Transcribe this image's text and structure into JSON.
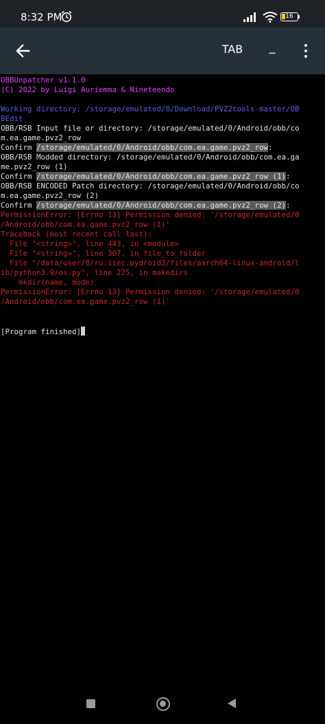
{
  "status_bar": {
    "time": "8:32 PM",
    "battery": "16",
    "icons": [
      "alarm-icon",
      "signal-icon",
      "wifi-icon",
      "battery-icon"
    ]
  },
  "app_bar": {
    "back_icon": "arrow-left-icon",
    "tab_label": "TAB",
    "underscore_label": "_",
    "menu_icon": "more-vertical-icon"
  },
  "terminal": {
    "header_1": "OBBUnpatcher v1.1.0",
    "header_2": "(C) 2022 by Luigi Auriemma & Nineteendo",
    "working_dir_1": "Working directory: /storage/emulated/0/Download/PVZ2tools-master/OB",
    "working_dir_2": "BEdit",
    "input_1": "OBB/RSB Input file or directory: /storage/emulated/0/Android/obb/co",
    "input_2": "m.ea.game.pvz2_row",
    "confirm_label": "Confirm ",
    "confirm_1_value": "/storage/emulated/0/Android/obb/com.ea.game.pvz2_row",
    "confirm_1_end": ":",
    "modded_1": "OBB/RSB Modded directory: /storage/emulated/0/Android/obb/com.ea.ga",
    "modded_2": "me.pvz2_row (1)",
    "confirm_2_value": "/storage/emulated/0/Android/obb/com.ea.game.pvz2_row (1)",
    "confirm_2_end": ":",
    "encoded_1": "OBB/RSB ENCODED Patch directory: /storage/emulated/0/Android/obb/co",
    "encoded_2": "m.ea.game.pvz2_row (2)",
    "confirm_3_value": "/storage/emulated/0/Android/obb/com.ea.game.pvz2_row (2)",
    "confirm_3_end": ":",
    "error_1a": "PermissionError: [Errno 13] Permission denied: '/storage/emulated/0",
    "error_1b": "/Android/obb/com.ea.game.pvz2_row (1)'",
    "traceback": "Traceback (most recent call last):",
    "tb_1": "  File \"<string>\", line 443, in <module>",
    "tb_2": "  File \"<string>\", line 307, in file_to_folder",
    "tb_3a": "  File \"/data/user/0/ru.iiec.pydroid3/files/aarch64-linux-android/l",
    "tb_3b": "ib/python3.9/os.py\", line 225, in makedirs",
    "tb_4": "    mkdir(name, mode)",
    "error_2a": "PermissionError: [Errno 13] Permission denied: '/storage/emulated/0",
    "error_2b": "/Android/obb/com.ea.game.pvz2_row (1)'",
    "finished": "[Program finished]"
  },
  "nav_bar": {
    "icons": [
      "recent-apps-icon",
      "home-icon",
      "back-triangle-icon"
    ]
  },
  "colors": {
    "status_bg": "#1f2328",
    "app_bar_bg": "#263039",
    "terminal_bg": "#000000",
    "magenta": "#e040fb",
    "blue": "#5c5ce0",
    "error_red": "#c62828",
    "highlight": "#5a5a5a"
  }
}
